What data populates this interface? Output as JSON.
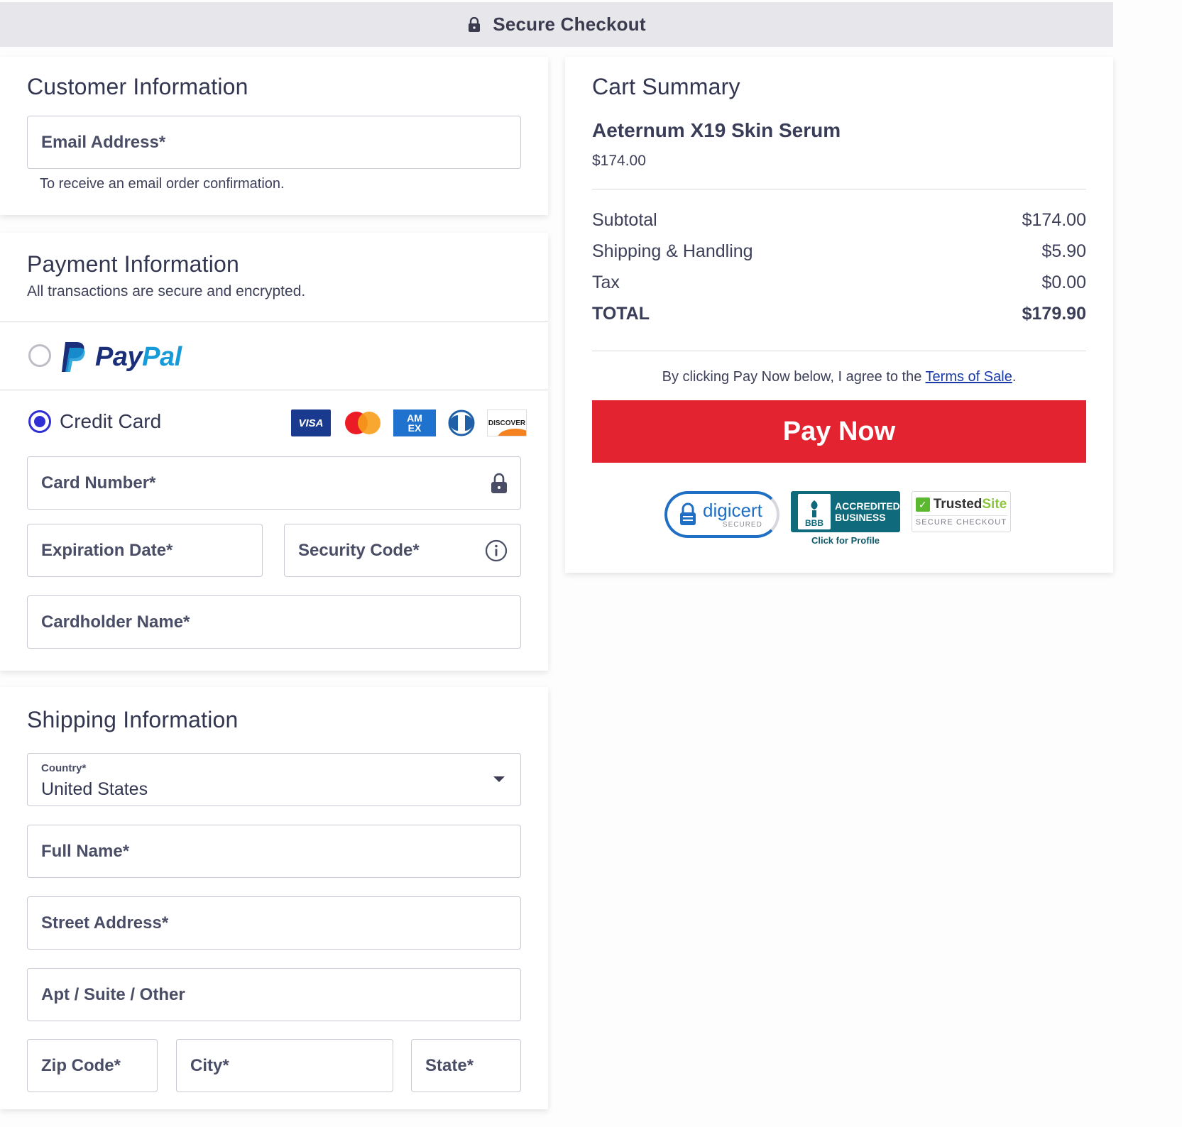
{
  "header": {
    "title": "Secure Checkout",
    "icon": "lock-icon"
  },
  "customer": {
    "title": "Customer Information",
    "email_placeholder": "Email Address*",
    "email_value": "",
    "email_hint": "To receive an email order confirmation."
  },
  "payment": {
    "title": "Payment Information",
    "subtitle": "All transactions are secure and encrypted.",
    "paypal": {
      "selected": false,
      "pay": "Pay",
      "pal": "Pal"
    },
    "credit_card": {
      "selected": true,
      "label": "Credit Card",
      "logos": {
        "visa": "VISA",
        "amex_line1": "AM",
        "amex_line2": "EX",
        "discover": "DISCOVER"
      },
      "card_number_placeholder": "Card Number*",
      "expiration_placeholder": "Expiration Date*",
      "security_code_placeholder": "Security Code*",
      "cardholder_placeholder": "Cardholder Name*"
    }
  },
  "shipping": {
    "title": "Shipping Information",
    "country_label": "Country*",
    "country_value": "United States",
    "full_name_placeholder": "Full Name*",
    "street_placeholder": "Street Address*",
    "apt_placeholder": "Apt / Suite / Other",
    "zip_placeholder": "Zip Code*",
    "city_placeholder": "City*",
    "state_placeholder": "State*"
  },
  "cart": {
    "title": "Cart Summary",
    "product_name": "Aeternum X19 Skin Serum",
    "product_price": "$174.00",
    "rows": [
      {
        "label": "Subtotal",
        "value": "$174.00"
      },
      {
        "label": "Shipping & Handling",
        "value": "$5.90"
      },
      {
        "label": "Tax",
        "value": "$0.00"
      },
      {
        "label": "TOTAL",
        "value": "$179.90"
      }
    ],
    "terms_prefix": "By clicking Pay Now below, I agree to the ",
    "terms_link": "Terms of Sale",
    "terms_suffix": ".",
    "pay_button": "Pay Now",
    "badges": {
      "digicert_main": "digicert",
      "digicert_sub": "SECURED",
      "bbb_logo": "BBB",
      "bbb_line1": "ACCREDITED",
      "bbb_line2": "BUSINESS",
      "bbb_link": "Click for Profile",
      "trusted_a": "Trusted",
      "trusted_b": "Site",
      "trusted_sub": "SECURE CHECKOUT"
    }
  },
  "colors": {
    "accent": "#2f2fd4",
    "pay_button": "#e3232f",
    "paypal_dark": "#1a2e7a",
    "paypal_light": "#169ad8"
  }
}
